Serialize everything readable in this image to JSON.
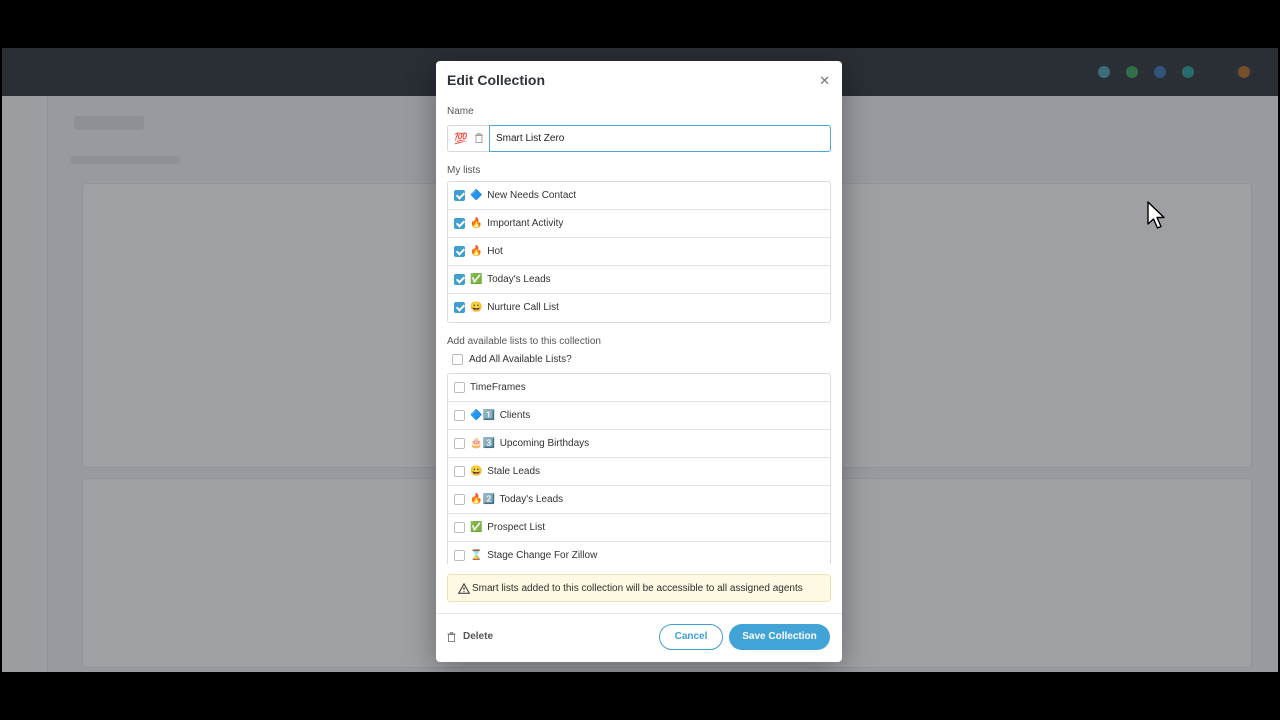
{
  "modal": {
    "title": "Edit Collection",
    "close_icon": "close-icon",
    "name_label": "Name",
    "name_emoji": "💯",
    "name_value": "Smart List Zero",
    "my_lists_label": "My lists",
    "my_lists": [
      {
        "icon": "🔷",
        "label": "New Needs Contact",
        "checked": true
      },
      {
        "icon": "🔥",
        "label": "Important Activity",
        "checked": true
      },
      {
        "icon": "🔥",
        "label": "Hot",
        "checked": true
      },
      {
        "icon": "✅",
        "label": "Today's Leads",
        "checked": true
      },
      {
        "icon": "😀",
        "label": "Nurture Call List",
        "checked": true
      }
    ],
    "available_label": "Add available lists to this collection",
    "add_all_label": "Add All Available Lists?",
    "available_lists": [
      {
        "icon": "",
        "label": "TimeFrames",
        "checked": false
      },
      {
        "icon": "🔷1️⃣",
        "label": "Clients",
        "checked": false
      },
      {
        "icon": "🎂3️⃣",
        "label": "Upcoming Birthdays",
        "checked": false
      },
      {
        "icon": "😀",
        "label": "Stale Leads",
        "checked": false
      },
      {
        "icon": "🔥2️⃣",
        "label": "Today's Leads",
        "checked": false
      },
      {
        "icon": "✅",
        "label": "Prospect List",
        "checked": false
      },
      {
        "icon": "⌛",
        "label": "Stage Change For Zillow",
        "checked": false
      }
    ],
    "warning_text": "Smart lists added to this collection will be accessible to all assigned agents",
    "delete_label": "Delete",
    "cancel_label": "Cancel",
    "save_label": "Save Collection"
  },
  "colors": {
    "accent": "#42a3d6",
    "warning_bg": "#fdf9e2",
    "overlay": "#282c32"
  }
}
